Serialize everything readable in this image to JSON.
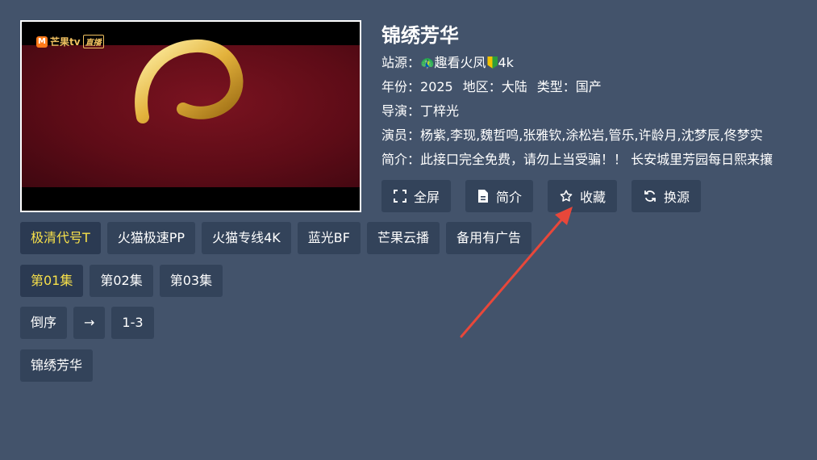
{
  "player": {
    "logo_text": "芒果tv",
    "logo_badge": "直播"
  },
  "detail": {
    "title": "锦绣芳华",
    "source_label": "站源：",
    "source_value": "趣看火凤",
    "source_suffix": "4k",
    "year_label": "年份：",
    "year_value": "2025",
    "region_label": "地区：",
    "region_value": "大陆",
    "type_label": "类型：",
    "type_value": "国产",
    "director_label": "导演：",
    "director_value": "丁梓光",
    "cast_label": "演员：",
    "cast_value": "杨紫,李现,魏哲鸣,张雅钦,涂松岩,管乐,许龄月,沈梦辰,佟梦实",
    "intro_label": "简介：",
    "intro_value": "此接口完全免费，请勿上当受骗！！ 长安城里芳园每日熙来攘"
  },
  "actions": {
    "fullscreen": "全屏",
    "intro": "简介",
    "favorite": "收藏",
    "switch_source": "换源"
  },
  "lines": [
    "极清代号T",
    "火猫极速PP",
    "火猫专线4K",
    "蓝光BF",
    "芒果云播",
    "备用有广告"
  ],
  "episodes": [
    "第01集",
    "第02集",
    "第03集"
  ],
  "order": {
    "reverse": "倒序",
    "arrow": "→",
    "range": "1-3"
  },
  "related": [
    "锦绣芳华"
  ],
  "colors": {
    "background": "#43536b",
    "button": "#33435a",
    "active_text": "#f7e04a",
    "annotation_arrow": "#e8473a"
  }
}
